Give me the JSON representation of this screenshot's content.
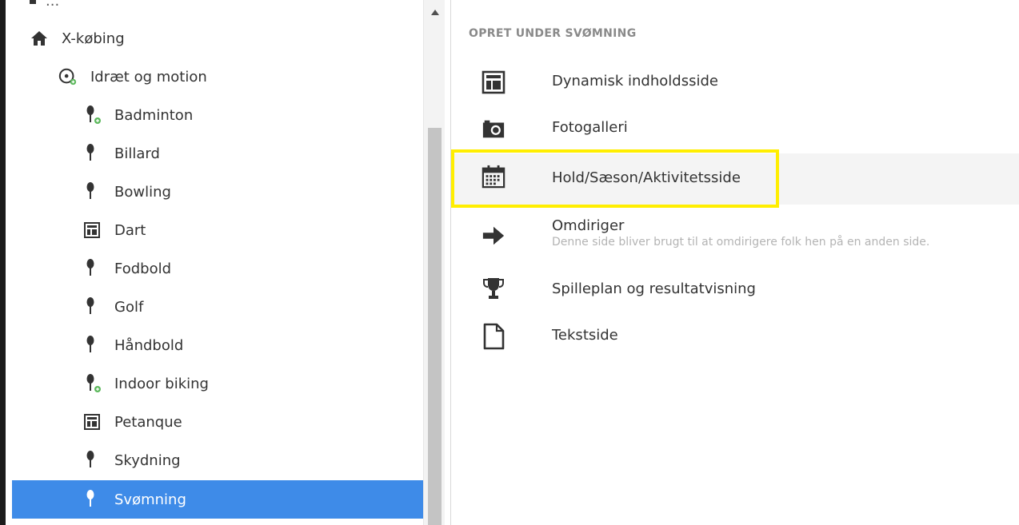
{
  "tree": {
    "partial_item_label": "...",
    "items": [
      {
        "label": "X-købing",
        "icon": "home-icon",
        "level": 0
      },
      {
        "label": "Idræt og motion",
        "icon": "sport-category-icon",
        "level": 1
      },
      {
        "label": "Badminton",
        "icon": "pin-add-icon",
        "level": 2
      },
      {
        "label": "Billard",
        "icon": "pin-icon",
        "level": 2
      },
      {
        "label": "Bowling",
        "icon": "pin-icon",
        "level": 2
      },
      {
        "label": "Dart",
        "icon": "layout-page-icon",
        "level": 2
      },
      {
        "label": "Fodbold",
        "icon": "pin-icon",
        "level": 2
      },
      {
        "label": "Golf",
        "icon": "pin-icon",
        "level": 2
      },
      {
        "label": "Håndbold",
        "icon": "pin-icon",
        "level": 2
      },
      {
        "label": "Indoor biking",
        "icon": "pin-add-icon",
        "level": 2
      },
      {
        "label": "Petanque",
        "icon": "layout-page-icon",
        "level": 2
      },
      {
        "label": "Skydning",
        "icon": "pin-icon",
        "level": 2
      },
      {
        "label": "Svømning",
        "icon": "pin-icon",
        "level": 2,
        "selected": true
      }
    ]
  },
  "create_panel": {
    "heading": "OPRET UNDER SVØMNING",
    "options": [
      {
        "name": "Dynamisk indholdsside",
        "icon": "layout-page-icon",
        "description": ""
      },
      {
        "name": "Fotogalleri",
        "icon": "camera-icon",
        "description": ""
      },
      {
        "name": "Hold/Sæson/Aktivitetsside",
        "icon": "calendar-icon",
        "description": "",
        "highlighted": true
      },
      {
        "name": "Omdiriger",
        "icon": "arrow-right-icon",
        "description": "Denne side bliver brugt til at omdirigere folk hen på en anden side."
      },
      {
        "name": "Spilleplan og resultatvisning",
        "icon": "trophy-icon",
        "description": ""
      },
      {
        "name": "Tekstside",
        "icon": "document-icon",
        "description": ""
      }
    ]
  },
  "colors": {
    "selected_bg": "#3e8be8",
    "highlight_border": "#ffee00",
    "heading_text": "#8a8a8a",
    "description_text": "#b4b4b4"
  }
}
